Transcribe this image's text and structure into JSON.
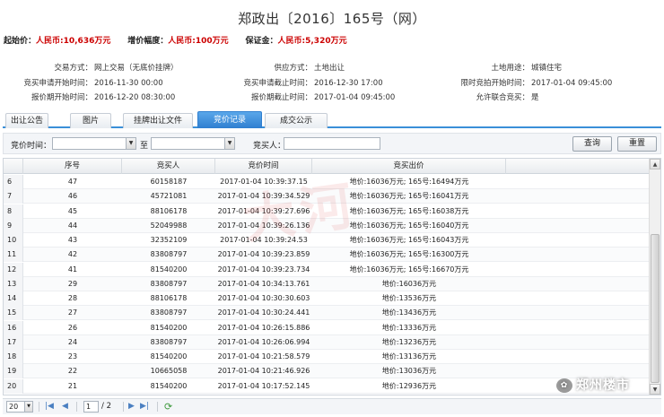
{
  "title": "郑政出〔2016〕165号（网）",
  "prices": [
    {
      "label": "起始价：",
      "value": "人民币:10,636万元"
    },
    {
      "label": "增价幅度：",
      "value": "人民币:100万元"
    },
    {
      "label": "保证金：",
      "value": "人民币:5,320万元"
    }
  ],
  "info": {
    "trade_mode_k": "交易方式：",
    "trade_mode_v": "网上交易（无底价挂牌）",
    "supply_k": "供应方式：",
    "supply_v": "土地出让",
    "use_k": "土地用途：",
    "use_v": "城镇住宅",
    "apply_start_k": "竞买申请开始时间：",
    "apply_start_v": "2016-11-30 00:00",
    "apply_end_k": "竞买申请截止时间：",
    "apply_end_v": "2016-12-30 17:00",
    "limit_start_k": "限时竞拍开始时间：",
    "limit_start_v": "2017-01-04 09:45:00",
    "quote_start_k": "报价期开始时间：",
    "quote_start_v": "2016-12-20 08:30:00",
    "quote_end_k": "报价期截止时间：",
    "quote_end_v": "2017-01-04 09:45:00",
    "joint_k": "允许联合竞买：",
    "joint_v": "是"
  },
  "tabs": [
    "出让公告",
    "图片",
    "挂牌出让文件",
    "竞价记录",
    "成交公示"
  ],
  "active_tab": "竞价记录",
  "filter": {
    "bid_time_label": "竞价时间：",
    "to_label": "至",
    "bidder_label": "竞买人：",
    "query_button": "查询",
    "reset_button": "重置"
  },
  "columns": [
    "序号",
    "竞买人",
    "竞价时间",
    "竞买出价"
  ],
  "rows": [
    {
      "idx": "6",
      "seq": "47",
      "bidder": "60158187",
      "time": "2017-01-04 10:39:37.15",
      "price": "地价:16036万元; 165号:16494万元"
    },
    {
      "idx": "7",
      "seq": "46",
      "bidder": "45721081",
      "time": "2017-01-04 10:39:34.529",
      "price": "地价:16036万元; 165号:16041万元"
    },
    {
      "idx": "8",
      "seq": "45",
      "bidder": "88106178",
      "time": "2017-01-04 10:39:27.696",
      "price": "地价:16036万元; 165号:16038万元"
    },
    {
      "idx": "9",
      "seq": "44",
      "bidder": "52049988",
      "time": "2017-01-04 10:39:26.136",
      "price": "地价:16036万元; 165号:16040万元"
    },
    {
      "idx": "10",
      "seq": "43",
      "bidder": "32352109",
      "time": "2017-01-04 10:39:24.53",
      "price": "地价:16036万元; 165号:16043万元"
    },
    {
      "idx": "11",
      "seq": "42",
      "bidder": "83808797",
      "time": "2017-01-04 10:39:23.859",
      "price": "地价:16036万元; 165号:16300万元"
    },
    {
      "idx": "12",
      "seq": "41",
      "bidder": "81540200",
      "time": "2017-01-04 10:39:23.734",
      "price": "地价:16036万元; 165号:16670万元"
    },
    {
      "idx": "13",
      "seq": "29",
      "bidder": "83808797",
      "time": "2017-01-04 10:34:13.761",
      "price": "地价:16036万元"
    },
    {
      "idx": "14",
      "seq": "28",
      "bidder": "88106178",
      "time": "2017-01-04 10:30:30.603",
      "price": "地价:13536万元"
    },
    {
      "idx": "15",
      "seq": "27",
      "bidder": "83808797",
      "time": "2017-01-04 10:30:24.441",
      "price": "地价:13436万元"
    },
    {
      "idx": "16",
      "seq": "26",
      "bidder": "81540200",
      "time": "2017-01-04 10:26:15.886",
      "price": "地价:13336万元"
    },
    {
      "idx": "17",
      "seq": "24",
      "bidder": "83808797",
      "time": "2017-01-04 10:26:06.994",
      "price": "地价:13236万元"
    },
    {
      "idx": "18",
      "seq": "23",
      "bidder": "81540200",
      "time": "2017-01-04 10:21:58.579",
      "price": "地价:13136万元"
    },
    {
      "idx": "19",
      "seq": "22",
      "bidder": "10665058",
      "time": "2017-01-04 10:21:46.926",
      "price": "地价:13036万元"
    },
    {
      "idx": "20",
      "seq": "21",
      "bidder": "81540200",
      "time": "2017-01-04 10:17:52.145",
      "price": "地价:12936万元"
    }
  ],
  "pager": {
    "page_size": "20",
    "current_page": "1",
    "total": "/ 2"
  },
  "watermark": "大河",
  "badge": "郑州楼市",
  "badge_icon": "wechat-icon"
}
